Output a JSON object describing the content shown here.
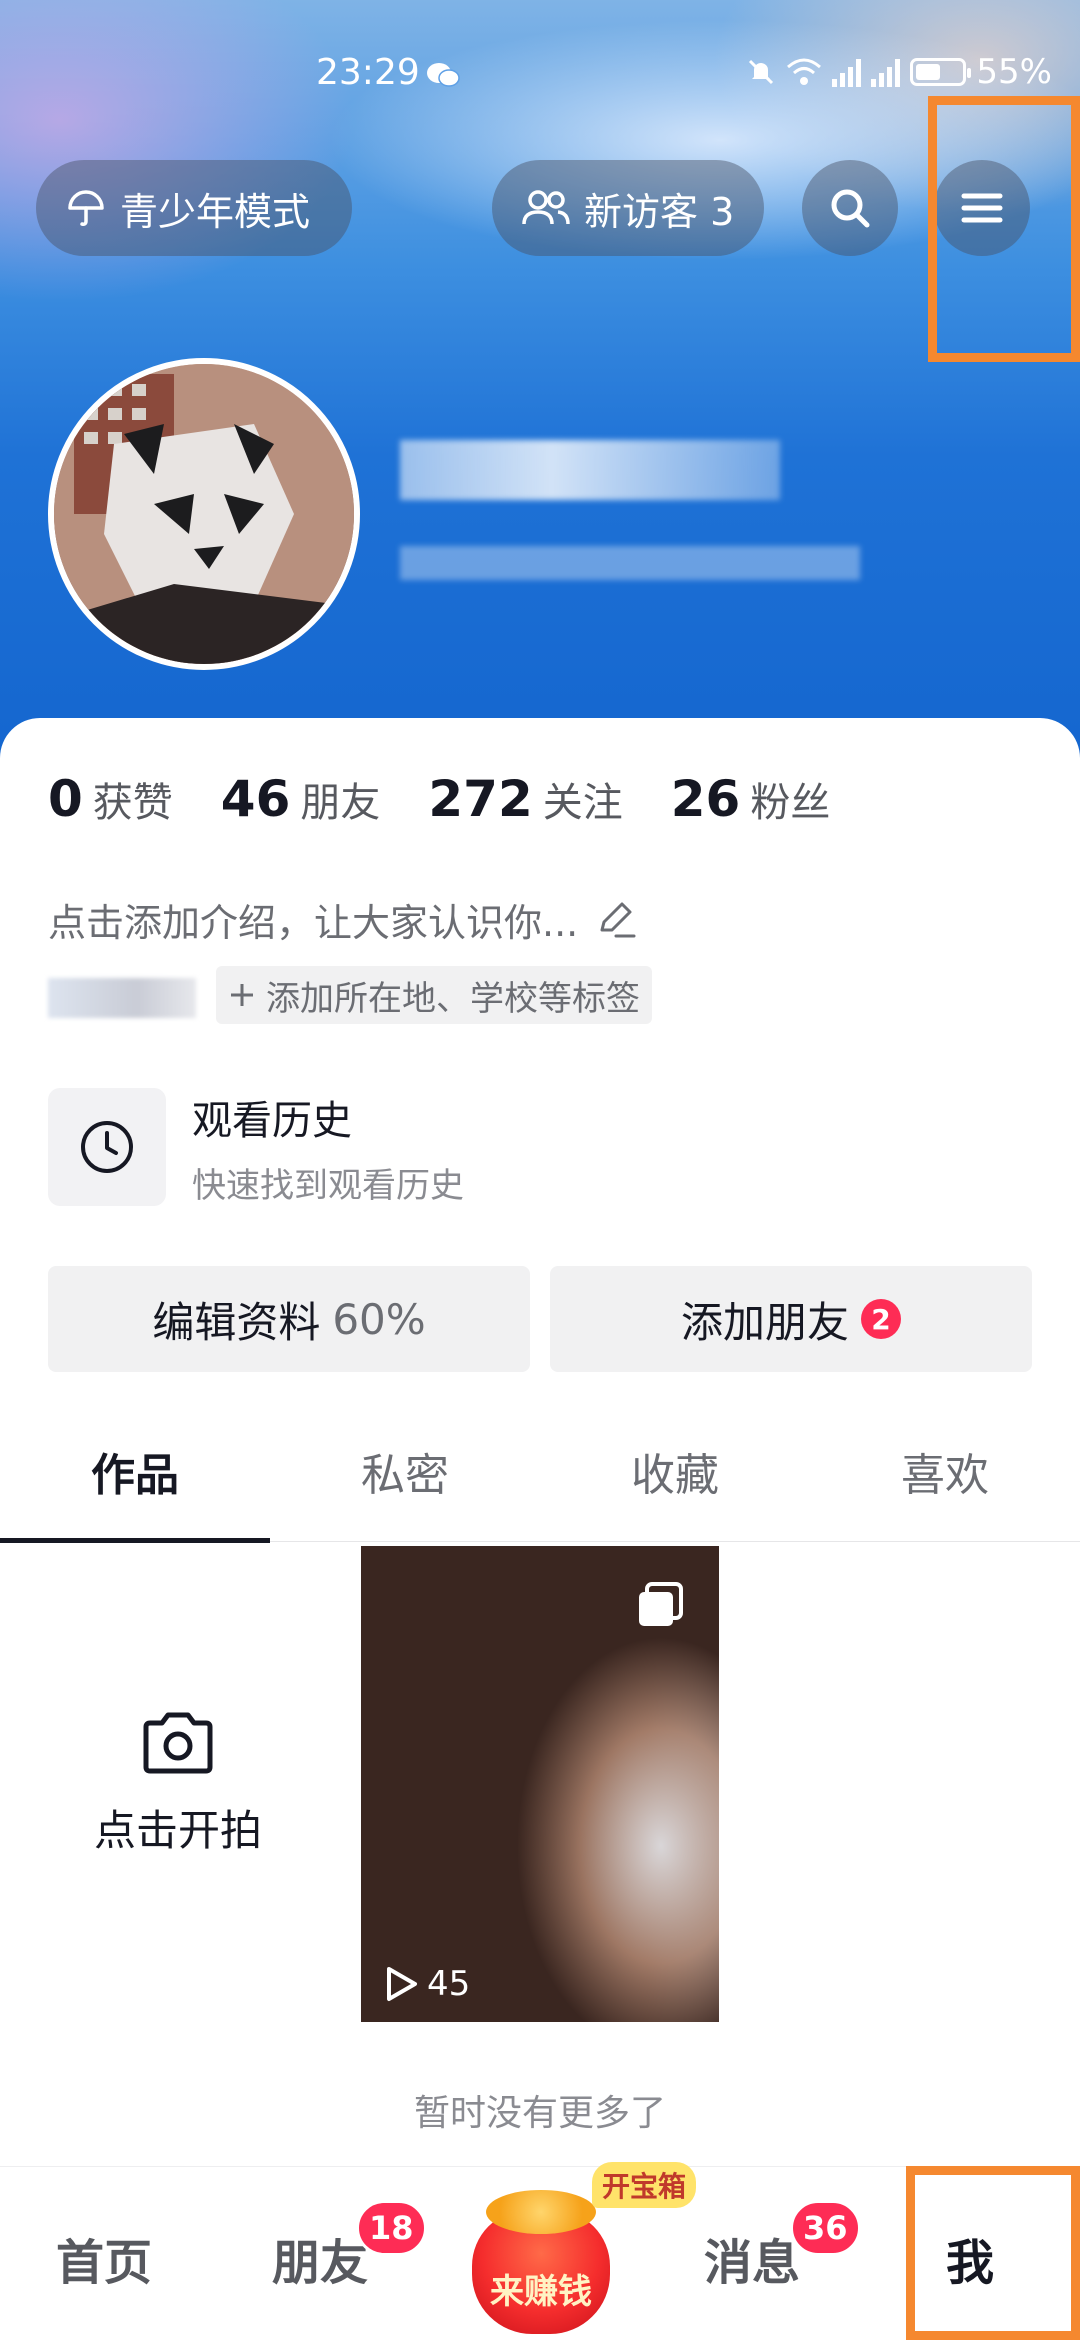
{
  "status_bar": {
    "time": "23:29",
    "battery": "55%",
    "battery_level": 0.55
  },
  "header": {
    "teen_mode_label": "青少年模式",
    "new_visitor_label": "新访客 3"
  },
  "stats": [
    {
      "num": "0",
      "label": "获赞"
    },
    {
      "num": "46",
      "label": "朋友"
    },
    {
      "num": "272",
      "label": "关注"
    },
    {
      "num": "26",
      "label": "粉丝"
    }
  ],
  "profile": {
    "intro_placeholder": "点击添加介绍，让大家认识你...",
    "add_tags_label": "添加所在地、学校等标签"
  },
  "history": {
    "title": "观看历史",
    "subtitle": "快速找到观看历史"
  },
  "actions": {
    "edit_label": "编辑资料",
    "edit_percent": "60%",
    "add_friend_label": "添加朋友",
    "add_friend_badge": "2"
  },
  "tabs": [
    {
      "label": "作品",
      "active": true
    },
    {
      "label": "私密",
      "active": false
    },
    {
      "label": "收藏",
      "active": false
    },
    {
      "label": "喜欢",
      "active": false
    }
  ],
  "grid": {
    "shoot_label": "点击开拍",
    "video_play_count": "45",
    "no_more_text": "暂时没有更多了"
  },
  "bottom_nav": {
    "home": "首页",
    "friends": "朋友",
    "friends_badge": "18",
    "earn": "来赚钱",
    "earn_tag": "开宝箱",
    "messages": "消息",
    "messages_badge": "36",
    "me": "我"
  },
  "colors": {
    "accent_red": "#fe2c55",
    "highlight_orange": "#f5882f",
    "header_blue": "#1f72d6"
  }
}
